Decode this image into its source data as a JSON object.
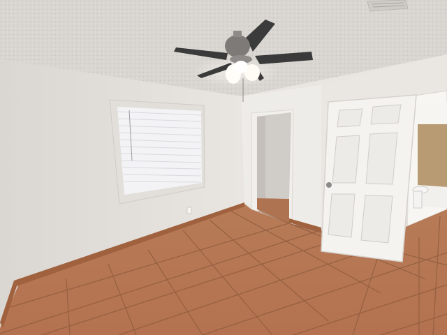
{
  "scene": {
    "kind": "photo",
    "subject": "empty-bedroom",
    "colors": {
      "ceiling": "#d7d5d1",
      "wall_left": "#e6e3df",
      "wall_back": "#eeece8",
      "wall_right": "#eae7e3",
      "floor_tile": "#b87a55",
      "grout": "#8d5a3d",
      "baseboard": "#a0623e",
      "door": "#f3f2ef",
      "closet_dark": "#cfcbc6",
      "fan_blade": "#3a3a3a",
      "fan_motor": "#7a7774",
      "light_glow": "#fffaf0",
      "blinds": "#f4f4f6",
      "bathroom_wall": "#b89a73"
    },
    "elements": [
      "textured-ceiling",
      "ceiling-fan",
      "air-vent",
      "window-with-blinds",
      "closet-opening",
      "open-panel-door",
      "bathroom-doorway",
      "tile-floor",
      "baseboard"
    ]
  }
}
